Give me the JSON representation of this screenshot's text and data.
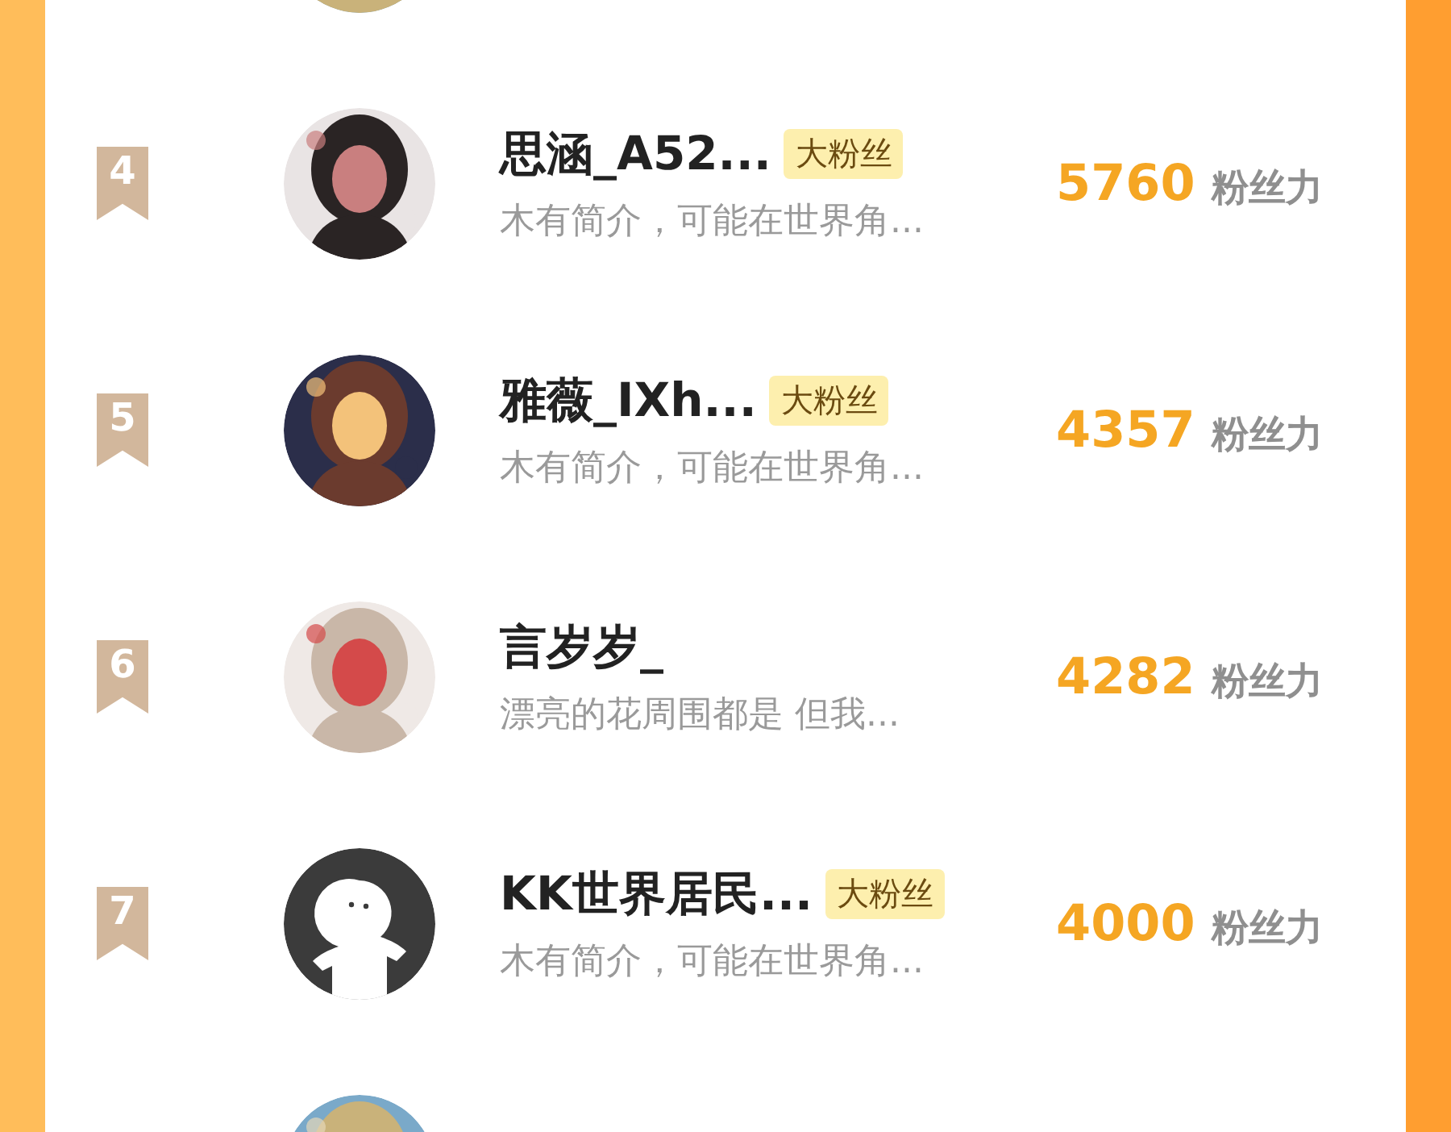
{
  "ranking": [
    {
      "kind": "partial"
    },
    {
      "kind": "full",
      "rank": "4",
      "name": "思涵_A52...",
      "badge": "大粉丝",
      "bio": "木有简介，可能在世界角...",
      "score": "5760",
      "unit": "粉丝力"
    },
    {
      "kind": "full",
      "rank": "5",
      "name": "雅薇_IXh...",
      "badge": "大粉丝",
      "bio": "木有简介，可能在世界角...",
      "score": "4357",
      "unit": "粉丝力"
    },
    {
      "kind": "full",
      "rank": "6",
      "name": "言岁岁_",
      "bio": "漂亮的花周围都是 但我...",
      "score": "4282",
      "unit": "粉丝力"
    },
    {
      "kind": "full",
      "rank": "7",
      "avatar": {
        "kind": "default"
      },
      "name": "KK世界居民...",
      "badge": "大粉丝",
      "bio": "木有简介，可能在世界角...",
      "score": "4000",
      "unit": "粉丝力"
    },
    {
      "kind": "partial"
    }
  ]
}
